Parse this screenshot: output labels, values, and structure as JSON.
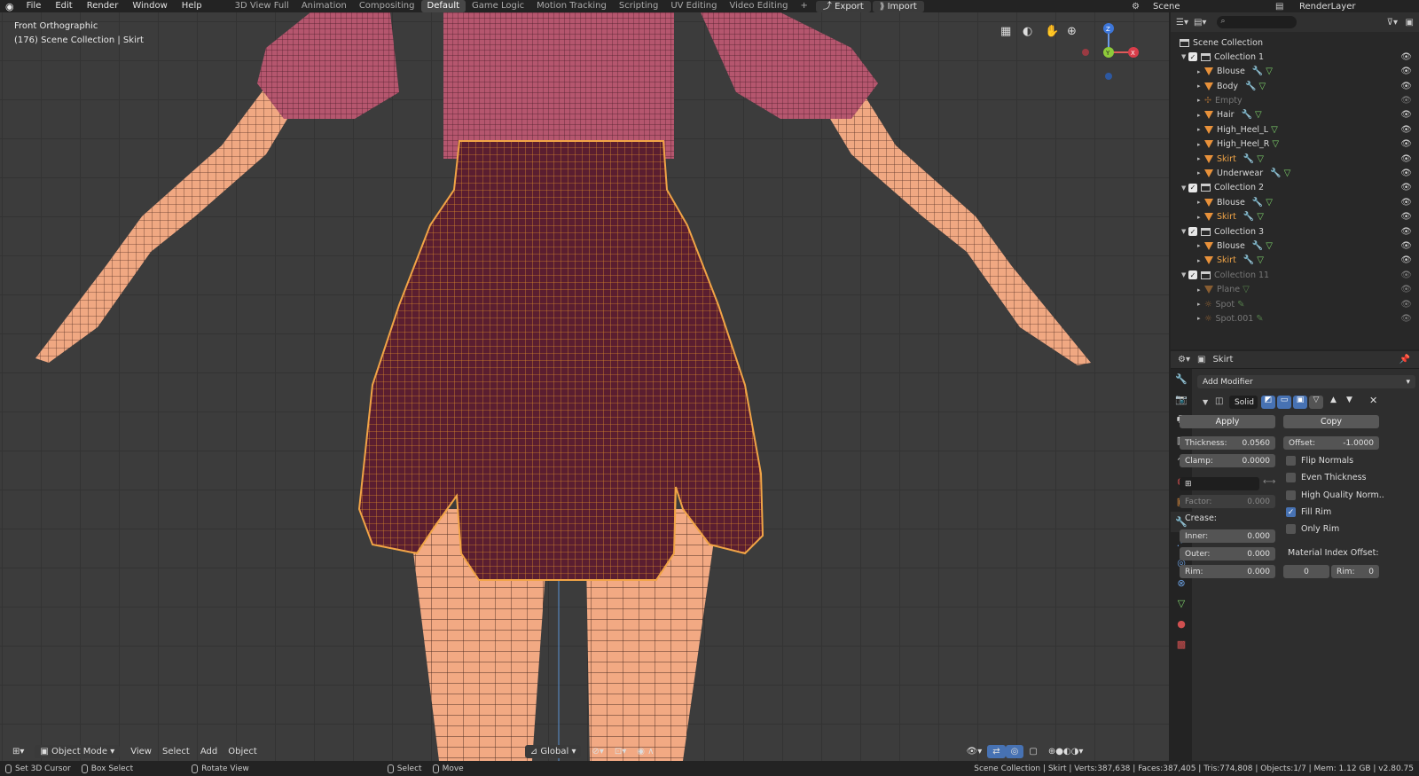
{
  "menus": [
    "File",
    "Edit",
    "Render",
    "Window",
    "Help"
  ],
  "workspaces": [
    "3D View Full",
    "Animation",
    "Compositing",
    "Default",
    "Game Logic",
    "Motion Tracking",
    "Scripting",
    "UV Editing",
    "Video Editing"
  ],
  "active_workspace": "Default",
  "top_buttons": {
    "plus": "+",
    "export": "Export",
    "import": "Import",
    "scene": "Scene",
    "render_layer": "RenderLayer"
  },
  "viewport": {
    "view_name": "Front Orthographic",
    "collection_info": "(176) Scene Collection | Skirt",
    "axes": {
      "z": "Z",
      "y": "Y",
      "x": "X"
    },
    "header": {
      "mode": "Object Mode",
      "view": "View",
      "select": "Select",
      "add": "Add",
      "object": "Object",
      "orientation": "Global"
    }
  },
  "statusbar": {
    "cursor": "Set 3D Cursor",
    "box": "Box Select",
    "rotate": "Rotate View",
    "select": "Select",
    "move": "Move",
    "stats": "Scene Collection | Skirt | Verts:387,638 | Faces:387,405 | Tris:774,808 | Objects:1/7 | Mem: 1.12 GB | v2.80.75"
  },
  "outliner": {
    "root": "Scene Collection",
    "rows": [
      {
        "label": "Collection 1",
        "type": "collection",
        "level": 1
      },
      {
        "label": "Blouse",
        "type": "mesh",
        "level": 2,
        "mod": true
      },
      {
        "label": "Body",
        "type": "mesh",
        "level": 2,
        "mod": true
      },
      {
        "label": "Empty",
        "type": "empty",
        "level": 2,
        "dim": true
      },
      {
        "label": "Hair",
        "type": "mesh",
        "level": 2,
        "mod": true
      },
      {
        "label": "High_Heel_L",
        "type": "mesh",
        "level": 2
      },
      {
        "label": "High_Heel_R",
        "type": "mesh",
        "level": 2
      },
      {
        "label": "Skirt",
        "type": "mesh",
        "level": 2,
        "mod": true,
        "selected": true
      },
      {
        "label": "Underwear",
        "type": "mesh",
        "level": 2,
        "mod": true
      },
      {
        "label": "Collection 2",
        "type": "collection",
        "level": 1
      },
      {
        "label": "Blouse",
        "type": "mesh",
        "level": 2,
        "mod": true
      },
      {
        "label": "Skirt",
        "type": "mesh",
        "level": 2,
        "mod": true,
        "selected": true
      },
      {
        "label": "Collection 3",
        "type": "collection",
        "level": 1
      },
      {
        "label": "Blouse",
        "type": "mesh",
        "level": 2,
        "mod": true
      },
      {
        "label": "Skirt",
        "type": "mesh",
        "level": 2,
        "mod": true,
        "selected": true
      },
      {
        "label": "Collection 11",
        "type": "collection",
        "level": 1,
        "dim": true
      },
      {
        "label": "Plane",
        "type": "mesh",
        "level": 2,
        "dim": true
      },
      {
        "label": "Spot",
        "type": "light",
        "level": 2,
        "dim": true
      },
      {
        "label": "Spot.001",
        "type": "light",
        "level": 2,
        "dim": true
      }
    ]
  },
  "properties": {
    "object": "Skirt",
    "add_modifier": "Add Modifier",
    "modifier_name": "Solid",
    "apply": "Apply",
    "copy": "Copy",
    "thickness_label": "Thickness:",
    "thickness": "0.0560",
    "offset_label": "Offset:",
    "offset": "-1.0000",
    "clamp_label": "Clamp:",
    "clamp": "0.0000",
    "factor_label": "Factor:",
    "factor": "0.000",
    "crease_label": "Crease:",
    "inner_label": "Inner:",
    "inner": "0.000",
    "outer_label": "Outer:",
    "outer": "0.000",
    "rim_label": "Rim:",
    "rim": "0.000",
    "flip_normals": "Flip Normals",
    "even_thickness": "Even Thickness",
    "hq_normals": "High Quality Norm..",
    "fill_rim": "Fill Rim",
    "only_rim": "Only Rim",
    "mat_index_label": "Material Index Offset:",
    "mat_index": "0",
    "mat_rim_label": "Rim:",
    "mat_rim": "0"
  },
  "colors": {
    "accent": "#4772b3",
    "selected": "#f1a446",
    "skirt": "#5a1e30",
    "skin": "#f0a882",
    "blouse": "#b5566e"
  }
}
